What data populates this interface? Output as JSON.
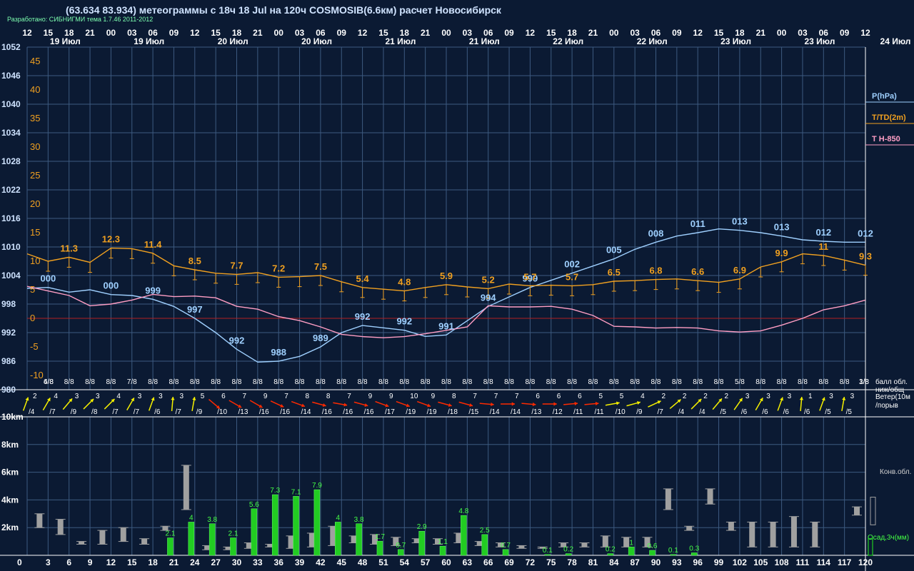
{
  "header": {
    "title": "(63.634 83.934) метеограммы с  18ч 18 Jul на 120ч COSMOSIB(6.6км) расчет Новосибирск",
    "credit": "Разработано: СИБНИГМИ тема 1.7.46 2011-2012"
  },
  "colors": {
    "background": "#0b1a33",
    "grid": "#3d5a80",
    "pressure": "#9fd0ff",
    "temperature": "#f0a020",
    "t850": "#ff9ec4",
    "wind_yellow": "#f5f000",
    "wind_red": "#ff2a00",
    "precip": "#22cc22",
    "cloud": "#a0a0a0",
    "text": "#ffffff"
  },
  "time_axis": {
    "hour_labels": [
      "12",
      "15",
      "18",
      "21",
      "00",
      "03",
      "06",
      "09",
      "12",
      "15",
      "18",
      "21",
      "00",
      "03",
      "06",
      "09",
      "12",
      "15",
      "18",
      "21",
      "00",
      "03",
      "06",
      "09",
      "12",
      "15",
      "18",
      "21",
      "00",
      "03",
      "06",
      "09",
      "12",
      "15",
      "18",
      "21",
      "00",
      "03",
      "06",
      "09",
      "12"
    ],
    "date_labels": [
      "19 Июл",
      "19 Июл",
      "20 Июл",
      "20 Июл",
      "21 Июл",
      "21 Июл",
      "22 Июл",
      "22 Июл",
      "23 Июл",
      "23 Июл"
    ],
    "right_date_label": "24 Июл",
    "step_labels": [
      "3",
      "6",
      "9",
      "12",
      "15",
      "18",
      "21",
      "24",
      "27",
      "30",
      "33",
      "36",
      "39",
      "42",
      "45",
      "48",
      "51",
      "54",
      "57",
      "60",
      "63",
      "66",
      "69",
      "72",
      "75",
      "78",
      "81",
      "84",
      "87",
      "90",
      "93",
      "96",
      "99",
      "102",
      "105",
      "108",
      "111",
      "114",
      "117",
      "120"
    ],
    "zero_label": "0"
  },
  "chart_data": [
    {
      "type": "line",
      "title": "(63.634 83.934) метеограммы с  18ч 18 Jul на 120ч COSMOSIB(6.6км) расчет Новосибирск",
      "x_unit": "ч",
      "pressure_axis_ticks": [
        "1052",
        "1046",
        "1040",
        "1034",
        "1028",
        "1022",
        "1016",
        "1010",
        "1004",
        "998",
        "992",
        "986",
        "980"
      ],
      "pressure_axis_range": [
        980,
        1052
      ],
      "temperature_axis_ticks": [
        "45",
        "40",
        "35",
        "30",
        "25",
        "20",
        "15",
        "10",
        "5",
        "0",
        "-5",
        "-10"
      ],
      "temperature_axis_range": [
        -12,
        49
      ],
      "legend": [
        {
          "label": "P(hPa)",
          "color": "#9fd0ff"
        },
        {
          "label": "T/TD(2m)",
          "color": "#f0a020"
        },
        {
          "label": "T H-850",
          "color": "#ff9ec4"
        }
      ],
      "series": [
        {
          "name": "P(hPa)",
          "x": [
            0,
            3,
            6,
            9,
            12,
            15,
            18,
            21,
            24,
            27,
            30,
            33,
            36,
            39,
            42,
            45,
            48,
            51,
            54,
            57,
            60,
            63,
            66,
            69,
            72,
            75,
            78,
            81,
            84,
            87,
            90,
            93,
            96,
            99,
            102,
            105,
            108,
            111,
            114,
            117,
            120
          ],
          "y": [
            1001.3,
            1001.5,
            1000.5,
            1001.0,
            1000.0,
            999.8,
            999.0,
            997.5,
            995.0,
            992.0,
            988.5,
            985.8,
            986.0,
            987.0,
            989.0,
            992.0,
            993.5,
            993.0,
            992.5,
            991.2,
            991.5,
            994.5,
            997.5,
            999.5,
            1001.5,
            1003.0,
            1004.5,
            1006.0,
            1007.5,
            1009.5,
            1011.0,
            1012.3,
            1013.0,
            1013.8,
            1013.5,
            1013.0,
            1012.3,
            1011.5,
            1011.2,
            1011.0,
            1011.0
          ],
          "labels": [
            {
              "x": 3,
              "text": "000"
            },
            {
              "x": 12,
              "text": "000"
            },
            {
              "x": 18,
              "text": "999"
            },
            {
              "x": 24,
              "text": "997"
            },
            {
              "x": 30,
              "text": "992"
            },
            {
              "x": 36,
              "text": "988"
            },
            {
              "x": 42,
              "text": "989"
            },
            {
              "x": 48,
              "text": "992"
            },
            {
              "x": 54,
              "text": "992"
            },
            {
              "x": 60,
              "text": "991"
            },
            {
              "x": 66,
              "text": "994"
            },
            {
              "x": 72,
              "text": "999"
            },
            {
              "x": 78,
              "text": "002"
            },
            {
              "x": 84,
              "text": "005"
            },
            {
              "x": 90,
              "text": "008"
            },
            {
              "x": 96,
              "text": "011"
            },
            {
              "x": 102,
              "text": "013"
            },
            {
              "x": 108,
              "text": "013"
            },
            {
              "x": 114,
              "text": "012"
            },
            {
              "x": 120,
              "text": "012"
            }
          ]
        },
        {
          "name": "T/TD(2m)",
          "x": [
            0,
            3,
            6,
            9,
            12,
            15,
            18,
            21,
            24,
            27,
            30,
            33,
            36,
            39,
            42,
            45,
            48,
            51,
            54,
            57,
            60,
            63,
            66,
            69,
            72,
            75,
            78,
            81,
            84,
            87,
            90,
            93,
            96,
            99,
            102,
            105,
            108,
            111,
            114,
            117,
            120
          ],
          "y": [
            11.3,
            10.0,
            10.7,
            9.8,
            12.3,
            12.2,
            11.4,
            9.2,
            8.5,
            7.9,
            7.7,
            8.0,
            7.2,
            7.3,
            7.5,
            6.4,
            5.4,
            5.1,
            4.8,
            5.4,
            5.9,
            5.5,
            5.2,
            6.0,
            5.7,
            5.8,
            5.7,
            5.9,
            6.5,
            6.6,
            6.8,
            6.9,
            6.6,
            6.3,
            6.9,
            9.0,
            9.9,
            11.3,
            11.0,
            10.2,
            9.3
          ],
          "labels": [
            {
              "x": 6,
              "text": "11.3"
            },
            {
              "x": 12,
              "text": "12.3"
            },
            {
              "x": 18,
              "text": "11.4"
            },
            {
              "x": 24,
              "text": "8.5"
            },
            {
              "x": 30,
              "text": "7.7"
            },
            {
              "x": 36,
              "text": "7.2"
            },
            {
              "x": 42,
              "text": "7.5"
            },
            {
              "x": 48,
              "text": "5.4"
            },
            {
              "x": 54,
              "text": "4.8"
            },
            {
              "x": 60,
              "text": "5.9"
            },
            {
              "x": 66,
              "text": "5.2"
            },
            {
              "x": 72,
              "text": "5.7"
            },
            {
              "x": 78,
              "text": "5.7"
            },
            {
              "x": 84,
              "text": "6.5"
            },
            {
              "x": 90,
              "text": "6.8"
            },
            {
              "x": 96,
              "text": "6.6"
            },
            {
              "x": 102,
              "text": "6.9"
            },
            {
              "x": 108,
              "text": "9.9"
            },
            {
              "x": 114,
              "text": "11"
            },
            {
              "x": 120,
              "text": "9.3"
            }
          ]
        },
        {
          "name": "T H-850",
          "x": [
            0,
            3,
            6,
            9,
            12,
            15,
            18,
            21,
            24,
            27,
            30,
            33,
            36,
            39,
            42,
            45,
            48,
            51,
            54,
            57,
            60,
            63,
            66,
            69,
            72,
            75,
            78,
            81,
            84,
            87,
            90,
            93,
            96,
            99,
            102,
            105,
            108,
            111,
            114,
            117,
            120
          ],
          "y": [
            5.6,
            4.8,
            4.0,
            2.2,
            2.5,
            3.2,
            4.2,
            3.8,
            3.9,
            3.6,
            2.1,
            1.6,
            0.3,
            -0.4,
            -1.5,
            -2.8,
            -3.2,
            -3.4,
            -3.2,
            -2.7,
            -2.1,
            -1.5,
            2.2,
            2.0,
            2.0,
            2.1,
            1.6,
            0.5,
            -1.4,
            -1.5,
            -1.7,
            -1.6,
            -1.7,
            -2.2,
            -2.4,
            -2.2,
            -1.2,
            0,
            1.5,
            2.2,
            3.2
          ]
        }
      ]
    },
    {
      "type": "table",
      "title": "балл обл. ниж/общ",
      "cloud_labels": [
        "4/8",
        "6/8",
        "8/8",
        "8/8",
        "8/8",
        "7/8",
        "8/8",
        "8/8",
        "8/8",
        "8/8",
        "8/8",
        "8/8",
        "8/8",
        "8/8",
        "8/8",
        "8/8",
        "8/8",
        "8/8",
        "8/8",
        "8/8",
        "8/8",
        "8/8",
        "8/8",
        "8/8",
        "8/8",
        "8/8",
        "8/8",
        "8/8",
        "8/8",
        "8/8",
        "8/8",
        "8/8",
        "8/8",
        "8/8",
        "5/8",
        "8/8",
        "8/8",
        "8/8",
        "8/8",
        "8/8",
        "3/8",
        "1/8"
      ]
    },
    {
      "type": "table",
      "title": "Ветер(10м)/порыв",
      "legend_line1": "Ветер(10м",
      "legend_line2": "/порыв",
      "wind_speed": [
        "2",
        "4",
        "3",
        "3",
        "4",
        "3",
        "3",
        "3",
        "5",
        "6",
        "7",
        "9",
        "7",
        "8",
        "8",
        "7",
        "9",
        "9",
        "10",
        "9",
        "8",
        "7",
        "7",
        "7",
        "6",
        "6",
        "6",
        "5",
        "5",
        "4",
        "2",
        "2",
        "2",
        "2",
        "3",
        "3",
        "3",
        "1",
        "3",
        "3"
      ],
      "wind_gust": [
        "/4",
        "/7",
        "/9",
        "/8",
        "/7",
        "/7",
        "/6",
        "/7",
        "/9",
        "/10",
        "/13",
        "/16",
        "/16",
        "/14",
        "/16",
        "/16",
        "/16",
        "/17",
        "/19",
        "/19",
        "/18",
        "/15",
        "/14",
        "/14",
        "/13",
        "/12",
        "/11",
        "/11",
        "/10",
        "/9",
        "/7",
        "/4",
        "/4",
        "/5",
        "/6",
        "/6",
        "/6",
        "/6",
        "/5",
        "/5"
      ],
      "wind_dir_deg": [
        200,
        210,
        220,
        225,
        225,
        210,
        200,
        185,
        190,
        310,
        300,
        300,
        295,
        290,
        285,
        280,
        285,
        290,
        290,
        290,
        285,
        285,
        275,
        270,
        275,
        270,
        265,
        265,
        260,
        255,
        245,
        230,
        225,
        220,
        215,
        210,
        200,
        185,
        200,
        190
      ],
      "wind_strong": [
        false,
        false,
        false,
        false,
        false,
        false,
        false,
        false,
        false,
        true,
        true,
        true,
        true,
        true,
        true,
        true,
        true,
        true,
        true,
        true,
        true,
        true,
        true,
        true,
        true,
        true,
        true,
        true,
        false,
        false,
        false,
        false,
        false,
        false,
        false,
        false,
        false,
        false,
        false,
        false
      ]
    },
    {
      "type": "bar",
      "title": "Осад,3ч(мм)",
      "height_axis_ticks": [
        "10km",
        "8km",
        "6km",
        "4km",
        "2km"
      ],
      "height_axis_range": [
        0,
        10.2
      ],
      "height_unit": "km",
      "legend": [
        {
          "label": "Конв.обл.",
          "color": "#a0a0a0"
        },
        {
          "label": "Осад,3ч(мм)",
          "color": "#22cc22"
        }
      ],
      "x": [
        3,
        6,
        9,
        12,
        15,
        18,
        21,
        24,
        27,
        30,
        33,
        36,
        39,
        42,
        45,
        48,
        51,
        54,
        57,
        60,
        63,
        66,
        69,
        72,
        75,
        78,
        81,
        84,
        87,
        90,
        93,
        96,
        99,
        102,
        105,
        108,
        111,
        114,
        117,
        120
      ],
      "precip_mm": [
        0,
        0,
        0,
        0,
        0,
        0,
        2.1,
        4.0,
        3.8,
        2.1,
        5.6,
        7.3,
        7.1,
        7.9,
        4.0,
        3.8,
        1.7,
        0.7,
        2.9,
        1.1,
        4.8,
        2.5,
        0.7,
        0,
        0.1,
        0.2,
        0,
        0.2,
        1.0,
        0.6,
        0.1,
        0.3,
        0,
        0,
        0,
        0,
        0,
        0,
        0,
        0
      ],
      "precip_labels": [
        "",
        "",
        "",
        "",
        "",
        "",
        "2.1",
        "4",
        "3.8",
        "2.1",
        "5.6",
        "7.3",
        "7.1",
        "7.9",
        "4",
        "3.8",
        "1.7",
        "0.7",
        "2.9",
        "1.1",
        "4.8",
        "2.5",
        "0.7",
        "",
        "0.1",
        "0.2",
        "",
        "0.2",
        "1",
        "0.6",
        "0.1",
        "0.3",
        "",
        "",
        "",
        "",
        "",
        "",
        "",
        ""
      ],
      "cloud_base_km": [
        2.0,
        1.5,
        0.8,
        0.8,
        1.0,
        0.8,
        1.8,
        3.3,
        0.4,
        0.4,
        0.5,
        0.6,
        0.5,
        0.6,
        0.7,
        0.9,
        0.8,
        0.7,
        0.9,
        0.8,
        0.9,
        0.7,
        0.6,
        0.5,
        0.5,
        0.6,
        0.6,
        0.6,
        0.6,
        0.6,
        3.3,
        1.8,
        3.7,
        1.8,
        0.6,
        0.6,
        0.6,
        0.6,
        0,
        2.9
      ],
      "cloud_top_km": [
        3.0,
        2.6,
        1.0,
        1.8,
        2.0,
        1.2,
        2.1,
        6.5,
        0.7,
        0.6,
        0.9,
        0.8,
        1.4,
        1.6,
        2.1,
        1.4,
        1.5,
        1.3,
        1.2,
        1.2,
        1.6,
        1.0,
        0.9,
        0.7,
        0.6,
        0.9,
        0.9,
        1.4,
        1.3,
        1.3,
        4.8,
        2.1,
        4.8,
        2.4,
        2.4,
        2.4,
        2.8,
        2.4,
        0,
        3.5
      ]
    }
  ]
}
